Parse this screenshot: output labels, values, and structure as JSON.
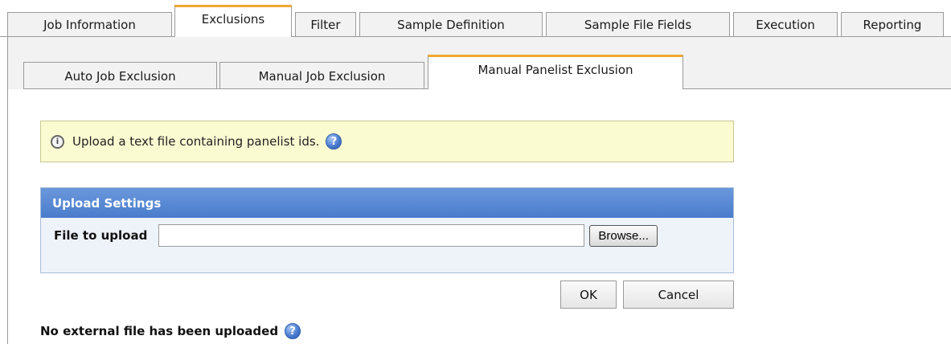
{
  "top_tabs": [
    {
      "label": "Job Information"
    },
    {
      "label": "Exclusions"
    },
    {
      "label": "Filter"
    },
    {
      "label": "Sample Definition"
    },
    {
      "label": "Sample File Fields"
    },
    {
      "label": "Execution"
    },
    {
      "label": "Reporting"
    }
  ],
  "active_top_tab": "Exclusions",
  "sub_tabs": [
    {
      "label": "Auto Job Exclusion"
    },
    {
      "label": "Manual Job Exclusion"
    },
    {
      "label": "Manual Panelist Exclusion"
    }
  ],
  "active_sub_tab": "Manual Panelist Exclusion",
  "info": {
    "message": "Upload a text file containing panelist ids.",
    "icon": "info-magnifier-icon",
    "help_icon": "help-icon"
  },
  "upload_panel": {
    "title": "Upload Settings",
    "file_label": "File to upload",
    "file_value": "",
    "browse_label": "Browse..."
  },
  "actions": {
    "ok_label": "OK",
    "cancel_label": "Cancel"
  },
  "status": {
    "message": "No external file has been uploaded"
  },
  "colors": {
    "active_tab_accent": "#f0a830",
    "panel_header": "#5a8ad4",
    "info_background": "#fbfbd2"
  }
}
